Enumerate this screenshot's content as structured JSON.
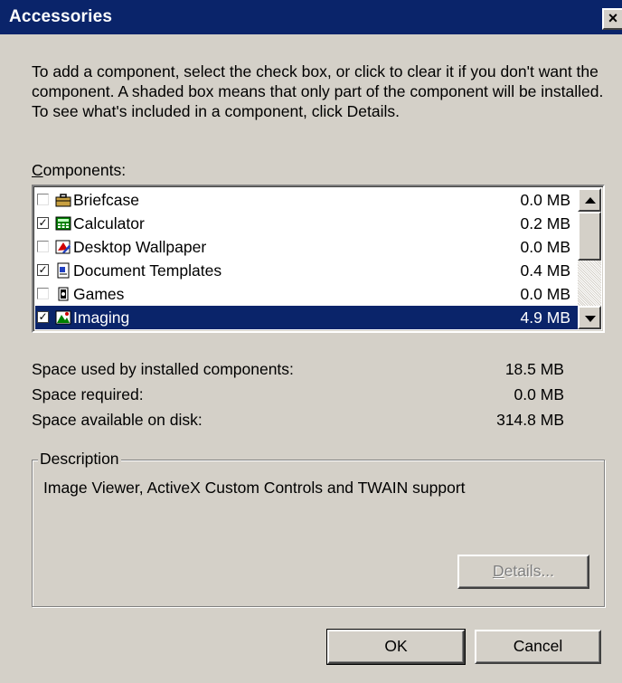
{
  "window": {
    "title": "Accessories",
    "close_glyph": "×"
  },
  "intro_text": "To add a component, select the check box, or click to clear it if you don't want the component. A shaded box means that only part of the component will be installed. To see what's included in a component, click Details.",
  "components": {
    "label_accel": "C",
    "label_rest": "omponents:",
    "items": [
      {
        "name": "Briefcase",
        "size": "0.0 MB",
        "checked": false,
        "icon": "briefcase-icon"
      },
      {
        "name": "Calculator",
        "size": "0.2 MB",
        "checked": true,
        "icon": "calculator-icon"
      },
      {
        "name": "Desktop Wallpaper",
        "size": "0.0 MB",
        "checked": false,
        "icon": "wallpaper-icon"
      },
      {
        "name": "Document Templates",
        "size": "0.4 MB",
        "checked": true,
        "icon": "document-icon"
      },
      {
        "name": "Games",
        "size": "0.0 MB",
        "checked": false,
        "icon": "games-icon"
      },
      {
        "name": "Imaging",
        "size": "4.9 MB",
        "checked": true,
        "selected": true,
        "icon": "imaging-icon"
      }
    ]
  },
  "space": {
    "used_label": "Space used by installed components:",
    "used_value": "18.5 MB",
    "required_label": "Space required:",
    "required_value": "0.0 MB",
    "available_label": "Space available on disk:",
    "available_value": "314.8 MB"
  },
  "description": {
    "title": "Description",
    "text": "Image Viewer, ActiveX Custom Controls and TWAIN support"
  },
  "buttons": {
    "details_accel": "D",
    "details_rest": "etails...",
    "ok": "OK",
    "cancel": "Cancel"
  },
  "colors": {
    "titlebar": "#0a246a",
    "face": "#d4d0c8",
    "selection": "#0a246a"
  }
}
